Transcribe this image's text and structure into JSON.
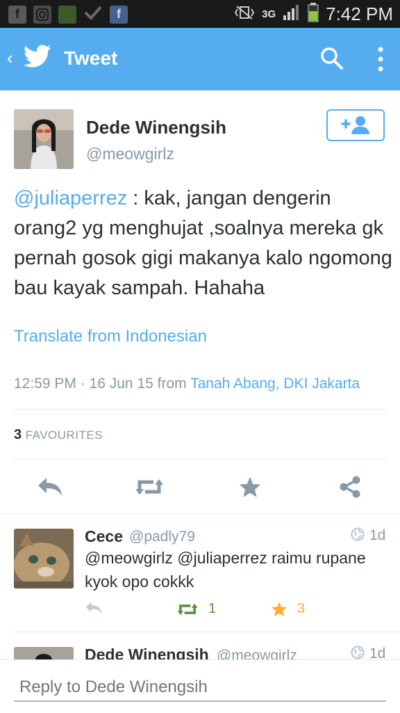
{
  "status_bar": {
    "time": "7:42 PM",
    "network": "3G",
    "left_icons": [
      "facebook-icon",
      "instagram-icon",
      "app-icon",
      "check-icon",
      "facebook-icon"
    ]
  },
  "app_bar": {
    "title": "Tweet",
    "color": "#55acee"
  },
  "tweet": {
    "author_name": "Dede Winengsih",
    "author_handle": "@meowgirlz",
    "mention": "@juliaperrez",
    "text": " : kak, jangan dengerin orang2 yg menghujat ,soalnya mereka gk pernah gosok gigi makanya kalo ngomong bau kayak sampah. Hahaha",
    "translate_label": "Translate from Indonesian",
    "timestamp": "12:59 PM · 16 Jun 15",
    "from_label": "from",
    "location": "Tanah Abang, DKI Jakarta",
    "favourites_count": "3",
    "favourites_label": "FAVOURITES"
  },
  "replies": [
    {
      "name": "Cece",
      "handle": "@padly79",
      "time": "1d",
      "text": "@meowgirlz @juliaperrez raimu rupane kyok opo cokkk",
      "retweets": "1",
      "favourites": "3"
    },
    {
      "name": "Dede Winengsih",
      "handle": "@meowgirlz",
      "time": "1d"
    }
  ],
  "reply_box": {
    "placeholder": "Reply to Dede Winengsih"
  },
  "colors": {
    "accent": "#55acee",
    "retweet": "#5c913b",
    "favourite": "#ffac33"
  }
}
